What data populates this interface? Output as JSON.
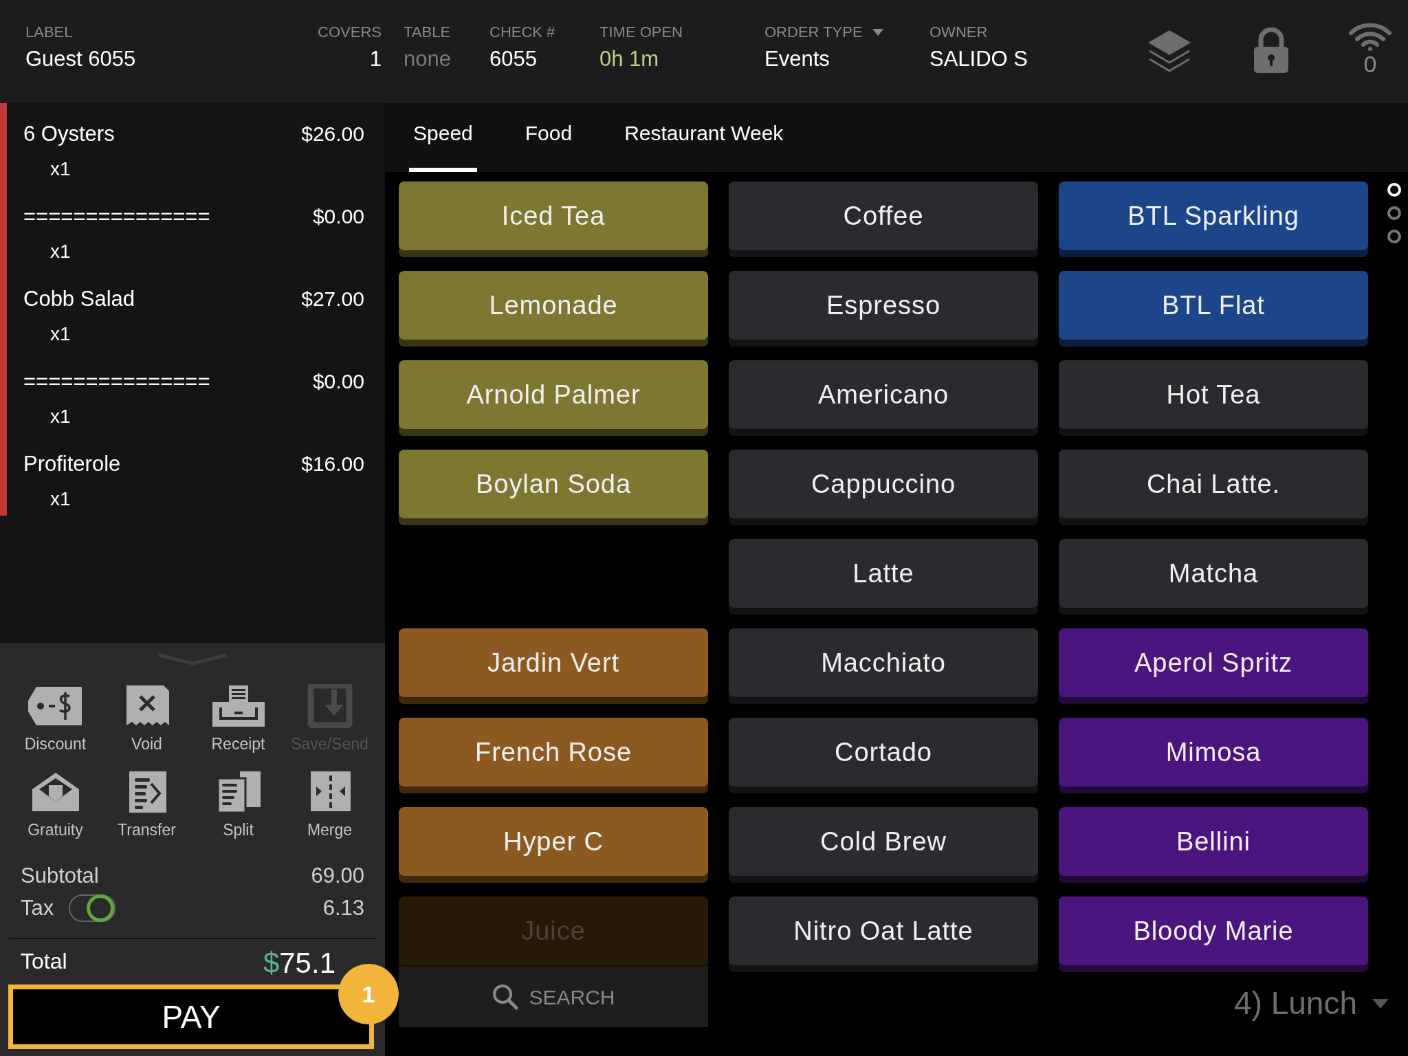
{
  "header": {
    "fields": [
      {
        "label": "LABEL",
        "value": "Guest 6055",
        "kind": "text"
      },
      {
        "label": "COVERS",
        "value": "1",
        "kind": "number"
      },
      {
        "label": "TABLE",
        "placeholder": "none",
        "kind": "text"
      },
      {
        "label": "CHECK #",
        "value": "6055",
        "kind": "text"
      },
      {
        "label": "TIME OPEN",
        "value": "0h 1m",
        "kind": "timer"
      },
      {
        "label": "ORDER TYPE",
        "value": "Events",
        "kind": "select"
      },
      {
        "label": "OWNER",
        "value": "SALIDO S",
        "kind": "text"
      }
    ],
    "wifi_count": "0"
  },
  "order": {
    "items": [
      {
        "name": "6 Oysters",
        "price": "$26.00",
        "qty": "x1"
      },
      {
        "name": "===============",
        "price": "$0.00",
        "qty": "x1"
      },
      {
        "name": "Cobb Salad",
        "price": "$27.00",
        "qty": "x1"
      },
      {
        "name": "===============",
        "price": "$0.00",
        "qty": "x1"
      },
      {
        "name": "Profiterole",
        "price": "$16.00",
        "qty": "x1"
      }
    ]
  },
  "actions": [
    {
      "kind": "discount",
      "label": "Discount",
      "disabled": false
    },
    {
      "kind": "void",
      "label": "Void",
      "disabled": false
    },
    {
      "kind": "receipt",
      "label": "Receipt",
      "disabled": false
    },
    {
      "kind": "save",
      "label": "Save/Send",
      "disabled": true
    },
    {
      "kind": "gratuity",
      "label": "Gratuity",
      "disabled": false
    },
    {
      "kind": "transfer",
      "label": "Transfer",
      "disabled": false
    },
    {
      "kind": "split",
      "label": "Split",
      "disabled": false
    },
    {
      "kind": "merge",
      "label": "Merge",
      "disabled": false
    }
  ],
  "totals": {
    "subtotal_label": "Subtotal",
    "subtotal": "69.00",
    "tax_label": "Tax",
    "tax_on": true,
    "tax": "6.13",
    "total_label": "Total",
    "total_currency": "$",
    "total": "75.1"
  },
  "pay": {
    "label": "PAY",
    "badge": "1"
  },
  "tabs": [
    {
      "label": "Speed",
      "selected": true
    },
    {
      "label": "Food",
      "selected": false
    },
    {
      "label": "Restaurant Week",
      "selected": false
    }
  ],
  "grid": {
    "columns": [
      [
        {
          "kind": "button",
          "label": "Iced Tea",
          "color": "#7d7732",
          "disabled": false
        },
        {
          "kind": "button",
          "label": "Lemonade",
          "color": "#7d7732",
          "disabled": false
        },
        {
          "kind": "button",
          "label": "Arnold Palmer",
          "color": "#7d7732",
          "disabled": false
        },
        {
          "kind": "button",
          "label": "Boylan Soda",
          "color": "#7d7732",
          "disabled": false
        },
        {
          "kind": "spacer"
        },
        {
          "kind": "button",
          "label": "Jardin Vert",
          "color": "#8c5a20",
          "disabled": false
        },
        {
          "kind": "button",
          "label": "French Rose",
          "color": "#8c5a20",
          "disabled": false
        },
        {
          "kind": "button",
          "label": "Hyper C",
          "color": "#8c5a20",
          "disabled": false
        },
        {
          "kind": "button",
          "label": "Juice",
          "disabled": true
        }
      ],
      [
        {
          "kind": "button",
          "label": "Coffee",
          "color": "#2a2b2f",
          "disabled": false
        },
        {
          "kind": "button",
          "label": "Espresso",
          "color": "#2a2b2f",
          "disabled": false
        },
        {
          "kind": "button",
          "label": "Americano",
          "color": "#2a2b2f",
          "disabled": false
        },
        {
          "kind": "button",
          "label": "Cappuccino",
          "color": "#2a2b2f",
          "disabled": false
        },
        {
          "kind": "button",
          "label": "Latte",
          "color": "#2a2b2f",
          "disabled": false
        },
        {
          "kind": "button",
          "label": "Macchiato",
          "color": "#2a2b2f",
          "disabled": false
        },
        {
          "kind": "button",
          "label": "Cortado",
          "color": "#2a2b2f",
          "disabled": false
        },
        {
          "kind": "button",
          "label": "Cold Brew",
          "color": "#2a2b2f",
          "disabled": false
        },
        {
          "kind": "button",
          "label": "Nitro Oat Latte",
          "color": "#2a2b2f",
          "disabled": false
        }
      ],
      [
        {
          "kind": "button",
          "label": "BTL Sparkling",
          "color": "#1c4689",
          "disabled": false
        },
        {
          "kind": "button",
          "label": "BTL Flat",
          "color": "#1c4689",
          "disabled": false
        },
        {
          "kind": "button",
          "label": "Hot Tea",
          "color": "#2a2b2f",
          "disabled": false
        },
        {
          "kind": "button",
          "label": "Chai Latte.",
          "color": "#2a2b2f",
          "disabled": false
        },
        {
          "kind": "button",
          "label": "Matcha",
          "color": "#2a2b2f",
          "disabled": false
        },
        {
          "kind": "button",
          "label": "Aperol Spritz",
          "color": "#4a157f",
          "disabled": false
        },
        {
          "kind": "button",
          "label": "Mimosa",
          "color": "#4a157f",
          "disabled": false
        },
        {
          "kind": "button",
          "label": "Bellini",
          "color": "#4a157f",
          "disabled": false
        },
        {
          "kind": "button",
          "label": "Bloody Marie",
          "color": "#4a157f",
          "disabled": false
        }
      ]
    ]
  },
  "pages": [
    {
      "selected": true
    },
    {
      "selected": false
    },
    {
      "selected": false
    }
  ],
  "search": {
    "label": "SEARCH"
  },
  "menu": {
    "label": "4) Lunch"
  }
}
